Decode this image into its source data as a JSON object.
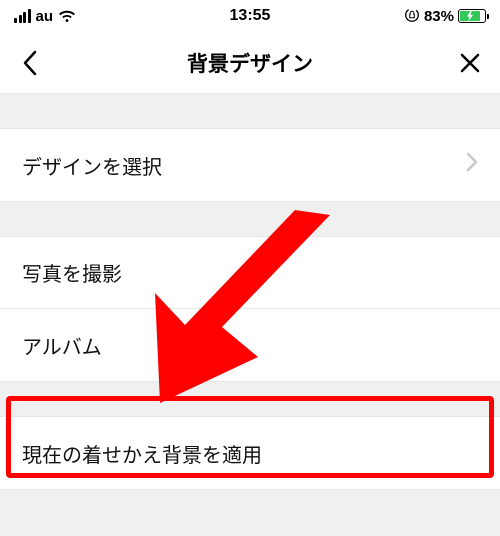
{
  "status": {
    "carrier": "au",
    "time": "13:55",
    "battery_pct": "83%"
  },
  "nav": {
    "title": "背景デザイン"
  },
  "cells": {
    "select_design": "デザインを選択",
    "take_photo": "写真を撮影",
    "album": "アルバム",
    "apply_current_theme": "現在の着せかえ背景を適用"
  },
  "annotation": {
    "highlight_color": "#ff0000"
  }
}
